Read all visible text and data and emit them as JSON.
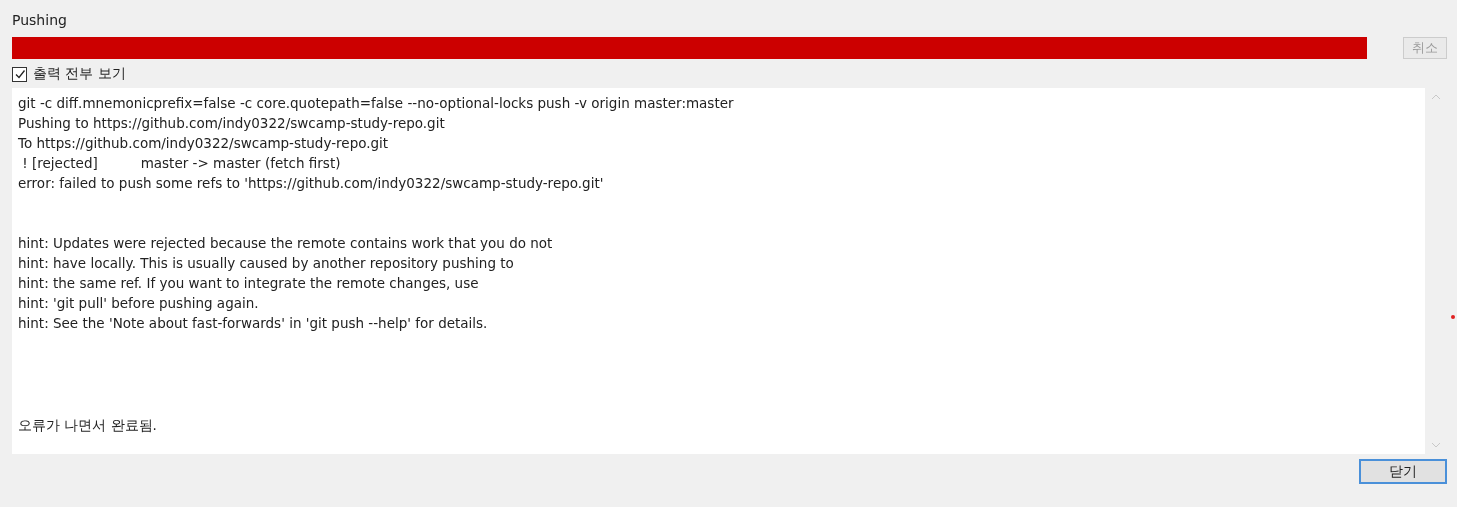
{
  "title": "Pushing",
  "progress": {
    "level": 1
  },
  "cancel_button": {
    "label": "취소",
    "disabled": true
  },
  "show_output": {
    "label": "출력 전부 보기",
    "checked": true
  },
  "output": {
    "blocks": [
      [
        "git -c diff.mnemonicprefix=false -c core.quotepath=false --no-optional-locks push -v origin master:master",
        "Pushing to https://github.com/indy0322/swcamp-study-repo.git",
        "To https://github.com/indy0322/swcamp-study-repo.git",
        " ! [rejected]          master -> master (fetch first)",
        "error: failed to push some refs to 'https://github.com/indy0322/swcamp-study-repo.git'"
      ],
      [
        "hint: Updates were rejected because the remote contains work that you do not",
        "hint: have locally. This is usually caused by another repository pushing to",
        "hint: the same ref. If you want to integrate the remote changes, use",
        "hint: 'git pull' before pushing again.",
        "hint: See the 'Note about fast-forwards' in 'git push --help' for details."
      ],
      [
        "오류가 나면서 완료됨."
      ]
    ]
  },
  "close_button": {
    "label": "닫기",
    "focused": true
  }
}
